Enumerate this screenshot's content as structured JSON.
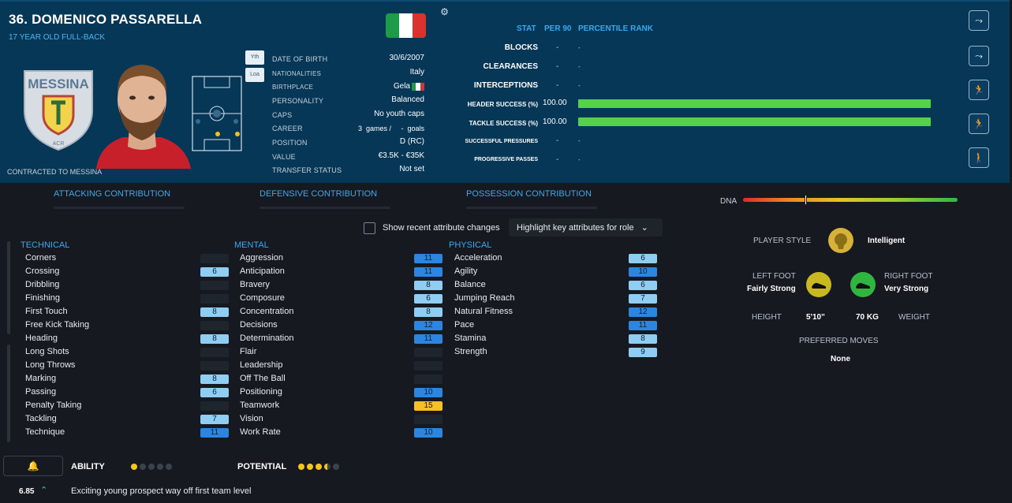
{
  "player": {
    "name": "36. DOMENICO PASSARELLA",
    "subtitle": "17 YEAR OLD FULL-BACK",
    "contracted": "CONTRACTED TO MESSINA",
    "club_crest_text": "MESSINA",
    "club_crest_sub": "ACR",
    "flag_colors": [
      "#1d9b48",
      "#ffffff",
      "#d9322f"
    ],
    "squad_tags": [
      "Yth",
      "Loa"
    ]
  },
  "info": [
    {
      "label": "DATE OF BIRTH",
      "value": "30/6/2007"
    },
    {
      "label": "NATIONALITIES",
      "value": "Italy"
    },
    {
      "label": "BIRTHPLACE",
      "value": "Gela"
    },
    {
      "label": "PERSONALITY",
      "value": "Balanced"
    },
    {
      "label": "CAPS",
      "value": "No youth caps"
    },
    {
      "label": "CAREER",
      "value": "3  games /     -  goals"
    },
    {
      "label": "POSITION",
      "value": "D (RC)"
    },
    {
      "label": "VALUE",
      "value": "€3.5K - €35K"
    },
    {
      "label": "TRANSFER STATUS",
      "value": "Not set"
    }
  ],
  "stats": {
    "headers": {
      "stat": "STAT",
      "per90": "PER 90",
      "rank": "PERCENTILE RANK"
    },
    "rows": [
      {
        "label": "BLOCKS",
        "per90": "-",
        "rank": "-",
        "bar": 0
      },
      {
        "label": "CLEARANCES",
        "per90": "-",
        "rank": "-",
        "bar": 0
      },
      {
        "label": "INTERCEPTIONS",
        "per90": "-",
        "rank": "-",
        "bar": 0
      },
      {
        "label": "HEADER SUCCESS (%)",
        "per90": "100.00",
        "rank": "",
        "bar": 100
      },
      {
        "label": "TACKLE SUCCESS (%)",
        "per90": "100.00",
        "rank": "",
        "bar": 100
      },
      {
        "label": "SUCCESSFUL PRESSURES",
        "per90": "-",
        "rank": "-",
        "bar": 0
      },
      {
        "label": "PROGRESSIVE PASSES",
        "per90": "-",
        "rank": "-",
        "bar": 0
      }
    ]
  },
  "contributions": {
    "attacking": "ATTACKING CONTRIBUTION",
    "defensive": "DEFENSIVE CONTRIBUTION",
    "possession": "POSSESSION CONTRIBUTION",
    "dna_label": "DNA"
  },
  "controls": {
    "show_changes": "Show recent attribute changes",
    "highlight": "Highlight key attributes for role"
  },
  "attributes": {
    "technical": {
      "title": "TECHNICAL",
      "items": [
        {
          "name": "Corners",
          "value": ""
        },
        {
          "name": "Crossing",
          "value": "6"
        },
        {
          "name": "Dribbling",
          "value": ""
        },
        {
          "name": "Finishing",
          "value": ""
        },
        {
          "name": "First Touch",
          "value": "8"
        },
        {
          "name": "Free Kick Taking",
          "value": ""
        },
        {
          "name": "Heading",
          "value": "8"
        },
        {
          "name": "Long Shots",
          "value": ""
        },
        {
          "name": "Long Throws",
          "value": ""
        },
        {
          "name": "Marking",
          "value": "8"
        },
        {
          "name": "Passing",
          "value": "6"
        },
        {
          "name": "Penalty Taking",
          "value": ""
        },
        {
          "name": "Tackling",
          "value": "7"
        },
        {
          "name": "Technique",
          "value": "11"
        }
      ]
    },
    "mental": {
      "title": "MENTAL",
      "items": [
        {
          "name": "Aggression",
          "value": "11"
        },
        {
          "name": "Anticipation",
          "value": "11"
        },
        {
          "name": "Bravery",
          "value": "8"
        },
        {
          "name": "Composure",
          "value": "6"
        },
        {
          "name": "Concentration",
          "value": "8"
        },
        {
          "name": "Decisions",
          "value": "12"
        },
        {
          "name": "Determination",
          "value": "11"
        },
        {
          "name": "Flair",
          "value": ""
        },
        {
          "name": "Leadership",
          "value": ""
        },
        {
          "name": "Off The Ball",
          "value": ""
        },
        {
          "name": "Positioning",
          "value": "10"
        },
        {
          "name": "Teamwork",
          "value": "15"
        },
        {
          "name": "Vision",
          "value": ""
        },
        {
          "name": "Work Rate",
          "value": "10"
        }
      ]
    },
    "physical": {
      "title": "PHYSICAL",
      "items": [
        {
          "name": "Acceleration",
          "value": "6"
        },
        {
          "name": "Agility",
          "value": "10"
        },
        {
          "name": "Balance",
          "value": "6"
        },
        {
          "name": "Jumping Reach",
          "value": "7"
        },
        {
          "name": "Natural Fitness",
          "value": "12"
        },
        {
          "name": "Pace",
          "value": "11"
        },
        {
          "name": "Stamina",
          "value": "8"
        },
        {
          "name": "Strength",
          "value": "9"
        }
      ]
    }
  },
  "profile": {
    "player_style_label": "PLAYER STYLE",
    "player_style_value": "Intelligent",
    "left_foot_label": "LEFT FOOT",
    "left_foot_value": "Fairly Strong",
    "right_foot_label": "RIGHT FOOT",
    "right_foot_value": "Very Strong",
    "height_label": "HEIGHT",
    "height_value": "5'10\"",
    "weight_value": "70 KG",
    "weight_label": "WEIGHT",
    "preferred_moves_label": "PREFERRED MOVES",
    "preferred_moves_value": "None"
  },
  "footer": {
    "ability_label": "ABILITY",
    "potential_label": "POTENTIAL",
    "ability_stars": 1,
    "potential_stars": 3.5,
    "rating": "6.85",
    "comment": "Exciting young prospect way off first team level"
  }
}
